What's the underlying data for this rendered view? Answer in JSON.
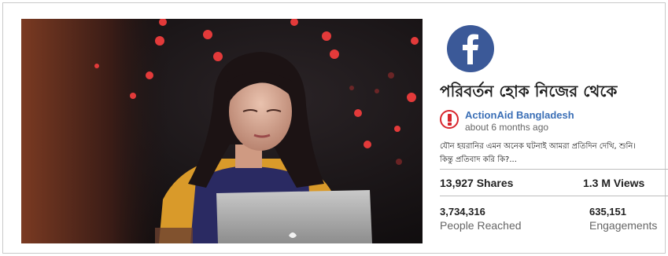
{
  "post": {
    "title": "পরিবর্তন হোক নিজের থেকে",
    "author": "ActionAid Bangladesh",
    "time": "about 6 months ago",
    "description_line1": "যৌন হয়রানির এমন অনেক ঘটনাই আমরা প্রতিদিন দেখি, শুনি।",
    "description_line2": "কিন্তু প্রতিবাদ করি কি?..."
  },
  "stats": {
    "shares": "13,927 Shares",
    "views": "1.3 M Views",
    "reached_value": "3,734,316",
    "reached_label": "People Reached",
    "engagements_value": "635,151",
    "engagements_label": "Engagements"
  },
  "icons": {
    "platform": "facebook-icon",
    "author_avatar": "actionaid-logo-icon"
  },
  "colors": {
    "facebook_blue": "#3b5998",
    "author_link": "#3b6fb6",
    "actionaid_red": "#d8262d"
  }
}
